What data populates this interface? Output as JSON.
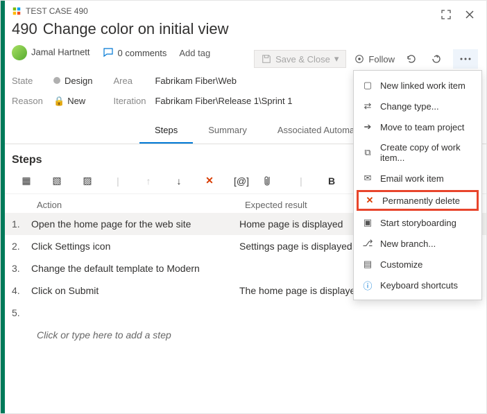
{
  "header": {
    "type_label": "TEST CASE 490",
    "id": "490",
    "title": "Change color on initial view",
    "assignee": "Jamal Hartnett",
    "comments_label": "0 comments",
    "add_tag": "Add tag",
    "save_label": "Save & Close",
    "follow_label": "Follow"
  },
  "fields": {
    "state_label": "State",
    "state_value": "Design",
    "reason_label": "Reason",
    "reason_value": "New",
    "area_label": "Area",
    "area_value": "Fabrikam Fiber\\Web",
    "iteration_label": "Iteration",
    "iteration_value": "Fabrikam Fiber\\Release 1\\Sprint 1"
  },
  "tabs": [
    "Steps",
    "Summary",
    "Associated Automation"
  ],
  "section_title": "Steps",
  "columns": {
    "action": "Action",
    "expected": "Expected result"
  },
  "steps": [
    {
      "n": "1.",
      "action": "Open the home page for the web site",
      "expected": "Home page is displayed"
    },
    {
      "n": "2.",
      "action": "Click Settings icon",
      "expected": "Settings page is displayed"
    },
    {
      "n": "3.",
      "action": "Change the default template to Modern",
      "expected": ""
    },
    {
      "n": "4.",
      "action": "Click on Submit",
      "expected": "The home page is displayed with the Modern look"
    },
    {
      "n": "5.",
      "action": "",
      "expected": ""
    }
  ],
  "placeholder": "Click or type here to add a step",
  "menu": {
    "items": [
      "New linked work item",
      "Change type...",
      "Move to team project",
      "Create copy of work item...",
      "Email work item",
      "Permanently delete",
      "Start storyboarding",
      "New branch...",
      "Customize",
      "Keyboard shortcuts"
    ]
  }
}
